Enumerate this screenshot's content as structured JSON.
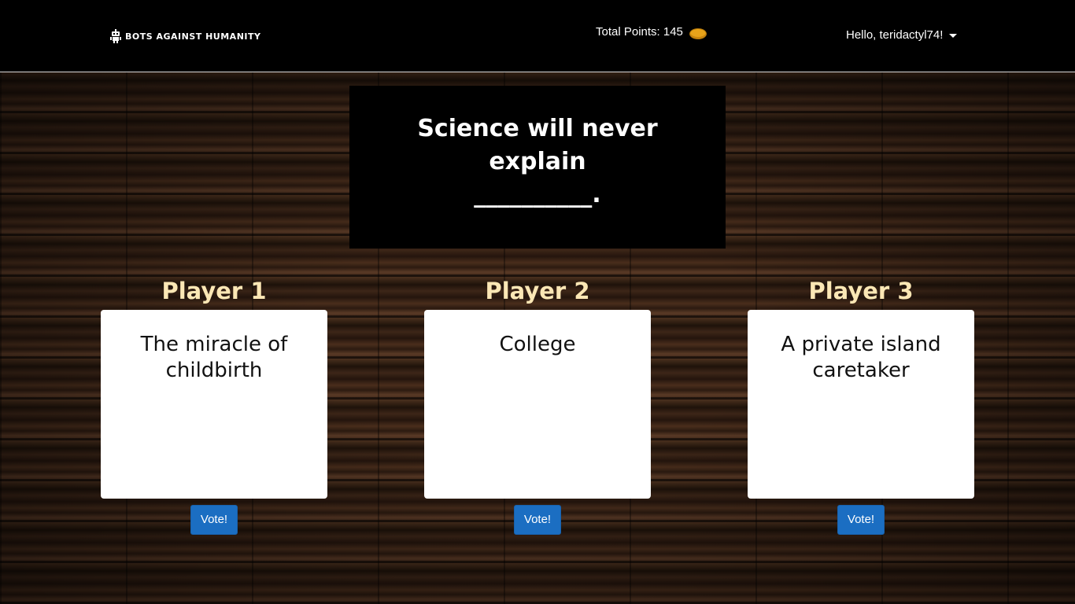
{
  "navbar": {
    "brand_text": "BOTS AGAINST HUMANITY",
    "brand_icon": "robot-icon",
    "points_label": "Total Points: 145",
    "coin_icon": "coin-icon",
    "greeting": "Hello, teridactyl74!",
    "dropdown_icon": "caret-down-icon"
  },
  "prompt": {
    "line1": "Science will never explain",
    "line2": "__________."
  },
  "players": [
    {
      "name": "Player 1",
      "answer": "The miracle of childbirth",
      "vote_label": "Vote!"
    },
    {
      "name": "Player 2",
      "answer": "College",
      "vote_label": "Vote!"
    },
    {
      "name": "Player 3",
      "answer": "A private island caretaker",
      "vote_label": "Vote!"
    }
  ],
  "colors": {
    "navbar_bg": "#000000",
    "player_title": "#fbe7b5",
    "vote_button": "#1b6ec2"
  }
}
